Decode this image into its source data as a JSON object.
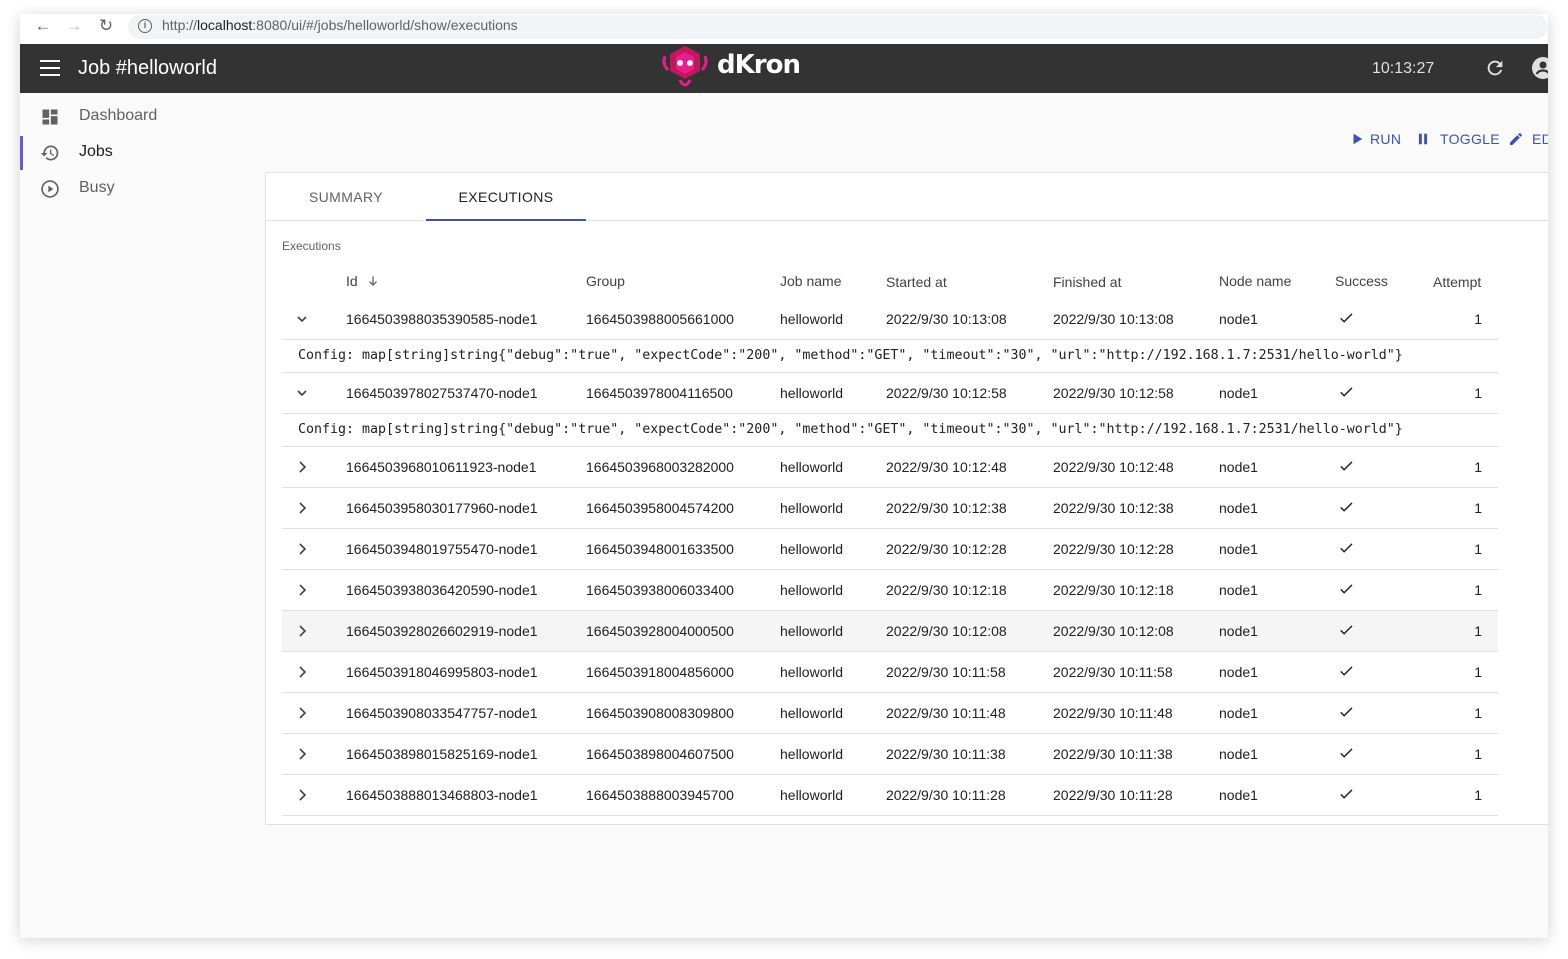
{
  "browser": {
    "url_prefix": "http://",
    "url_host": "localhost",
    "url_rest": ":8080/ui/#/jobs/helloworld/show/executions"
  },
  "appbar": {
    "title": "Job #helloworld",
    "logo_text": "dKron",
    "clock": "10:13:27"
  },
  "sidebar": {
    "items": [
      {
        "label": "Dashboard",
        "icon": "dashboard-icon"
      },
      {
        "label": "Jobs",
        "icon": "history-icon"
      },
      {
        "label": "Busy",
        "icon": "play-circle-icon"
      }
    ]
  },
  "actions": {
    "run": "RUN",
    "toggle": "TOGGLE",
    "edit": "ED"
  },
  "tabs": [
    "SUMMARY",
    "EXECUTIONS"
  ],
  "executions": {
    "label": "Executions",
    "columns": [
      "Id",
      "Group",
      "Job name",
      "Started at",
      "Finished at",
      "Node name",
      "Success",
      "Attempt"
    ],
    "config_text": "Config: map[string]string{\"debug\":\"true\", \"expectCode\":\"200\", \"method\":\"GET\", \"timeout\":\"30\", \"url\":\"http://192.168.1.7:2531/hello-world\"}",
    "rows": [
      {
        "id": "1664503988035390585-node1",
        "group": "1664503988005661000",
        "job": "helloworld",
        "started": "2022/9/30 10:13:08",
        "finished": "2022/9/30 10:13:08",
        "node": "node1",
        "attempt": "1",
        "expanded": true
      },
      {
        "id": "1664503978027537470-node1",
        "group": "1664503978004116500",
        "job": "helloworld",
        "started": "2022/9/30 10:12:58",
        "finished": "2022/9/30 10:12:58",
        "node": "node1",
        "attempt": "1",
        "expanded": true
      },
      {
        "id": "1664503968010611923-node1",
        "group": "1664503968003282000",
        "job": "helloworld",
        "started": "2022/9/30 10:12:48",
        "finished": "2022/9/30 10:12:48",
        "node": "node1",
        "attempt": "1",
        "expanded": false
      },
      {
        "id": "1664503958030177960-node1",
        "group": "1664503958004574200",
        "job": "helloworld",
        "started": "2022/9/30 10:12:38",
        "finished": "2022/9/30 10:12:38",
        "node": "node1",
        "attempt": "1",
        "expanded": false
      },
      {
        "id": "1664503948019755470-node1",
        "group": "1664503948001633500",
        "job": "helloworld",
        "started": "2022/9/30 10:12:28",
        "finished": "2022/9/30 10:12:28",
        "node": "node1",
        "attempt": "1",
        "expanded": false
      },
      {
        "id": "1664503938036420590-node1",
        "group": "1664503938006033400",
        "job": "helloworld",
        "started": "2022/9/30 10:12:18",
        "finished": "2022/9/30 10:12:18",
        "node": "node1",
        "attempt": "1",
        "expanded": false
      },
      {
        "id": "1664503928026602919-node1",
        "group": "1664503928004000500",
        "job": "helloworld",
        "started": "2022/9/30 10:12:08",
        "finished": "2022/9/30 10:12:08",
        "node": "node1",
        "attempt": "1",
        "expanded": false
      },
      {
        "id": "1664503918046995803-node1",
        "group": "1664503918004856000",
        "job": "helloworld",
        "started": "2022/9/30 10:11:58",
        "finished": "2022/9/30 10:11:58",
        "node": "node1",
        "attempt": "1",
        "expanded": false
      },
      {
        "id": "1664503908033547757-node1",
        "group": "1664503908008309800",
        "job": "helloworld",
        "started": "2022/9/30 10:11:48",
        "finished": "2022/9/30 10:11:48",
        "node": "node1",
        "attempt": "1",
        "expanded": false
      },
      {
        "id": "1664503898015825169-node1",
        "group": "1664503898004607500",
        "job": "helloworld",
        "started": "2022/9/30 10:11:38",
        "finished": "2022/9/30 10:11:38",
        "node": "node1",
        "attempt": "1",
        "expanded": false
      },
      {
        "id": "1664503888013468803-node1",
        "group": "1664503888003945700",
        "job": "helloworld",
        "started": "2022/9/30 10:11:28",
        "finished": "2022/9/30 10:11:28",
        "node": "node1",
        "attempt": "1",
        "expanded": false
      }
    ]
  },
  "colors": {
    "appbar": "#333333",
    "accent": "#3f51b5",
    "active_marker": "#6a5acd",
    "logo_pink": "#e91e8c"
  }
}
